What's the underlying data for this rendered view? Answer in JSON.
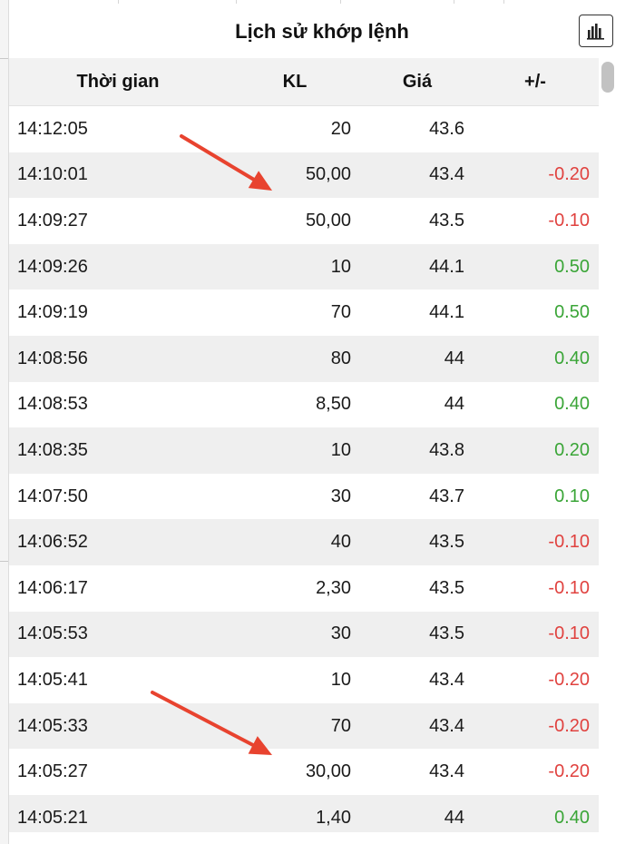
{
  "panel": {
    "title": "Lịch sử khớp lệnh",
    "chart_button_icon": "bar-chart-icon"
  },
  "columns": {
    "time": "Thời gian",
    "volume": "KL",
    "price": "Giá",
    "change": "+/-"
  },
  "rows": [
    {
      "time": "14:12:05",
      "volume": "20",
      "price": "43.6",
      "change": "",
      "direction": "none"
    },
    {
      "time": "14:10:01",
      "volume": "50,00",
      "price": "43.4",
      "change": "-0.20",
      "direction": "down"
    },
    {
      "time": "14:09:27",
      "volume": "50,00",
      "price": "43.5",
      "change": "-0.10",
      "direction": "down"
    },
    {
      "time": "14:09:26",
      "volume": "10",
      "price": "44.1",
      "change": "0.50",
      "direction": "up"
    },
    {
      "time": "14:09:19",
      "volume": "70",
      "price": "44.1",
      "change": "0.50",
      "direction": "up"
    },
    {
      "time": "14:08:56",
      "volume": "80",
      "price": "44",
      "change": "0.40",
      "direction": "up"
    },
    {
      "time": "14:08:53",
      "volume": "8,50",
      "price": "44",
      "change": "0.40",
      "direction": "up"
    },
    {
      "time": "14:08:35",
      "volume": "10",
      "price": "43.8",
      "change": "0.20",
      "direction": "up"
    },
    {
      "time": "14:07:50",
      "volume": "30",
      "price": "43.7",
      "change": "0.10",
      "direction": "up"
    },
    {
      "time": "14:06:52",
      "volume": "40",
      "price": "43.5",
      "change": "-0.10",
      "direction": "down"
    },
    {
      "time": "14:06:17",
      "volume": "2,30",
      "price": "43.5",
      "change": "-0.10",
      "direction": "down"
    },
    {
      "time": "14:05:53",
      "volume": "30",
      "price": "43.5",
      "change": "-0.10",
      "direction": "down"
    },
    {
      "time": "14:05:41",
      "volume": "10",
      "price": "43.4",
      "change": "-0.20",
      "direction": "down"
    },
    {
      "time": "14:05:33",
      "volume": "70",
      "price": "43.4",
      "change": "-0.20",
      "direction": "down"
    },
    {
      "time": "14:05:27",
      "volume": "30,00",
      "price": "43.4",
      "change": "-0.20",
      "direction": "down"
    },
    {
      "time": "14:05:21",
      "volume": "1,40",
      "price": "44",
      "change": "0.40",
      "direction": "up"
    }
  ],
  "colors": {
    "up": "#3aa537",
    "down": "#e0423f",
    "annotation_arrow": "#e8432f"
  },
  "annotations": [
    {
      "type": "arrow",
      "points_to_row": 1
    },
    {
      "type": "arrow",
      "points_to_row": 14
    }
  ]
}
